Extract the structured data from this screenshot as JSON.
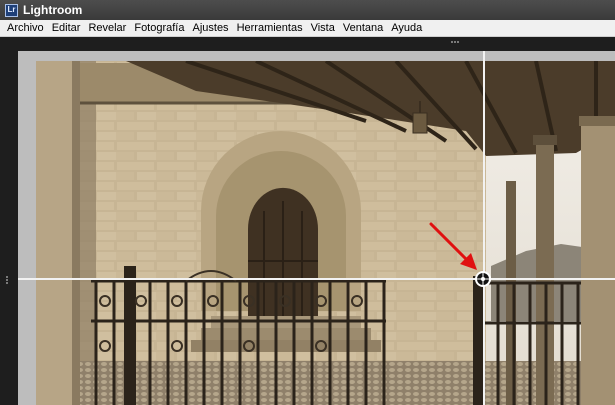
{
  "window": {
    "app_icon_text": "Lr",
    "title": "Lightroom"
  },
  "menu": {
    "items": [
      "Archivo",
      "Editar",
      "Revelar",
      "Fotografía",
      "Ajustes",
      "Herramientas",
      "Vista",
      "Ventana",
      "Ayuda"
    ]
  },
  "canvas": {
    "guide_color": "#f2f2f2",
    "annotation_arrow_color": "#e01010",
    "photo_tone": "sepia"
  }
}
